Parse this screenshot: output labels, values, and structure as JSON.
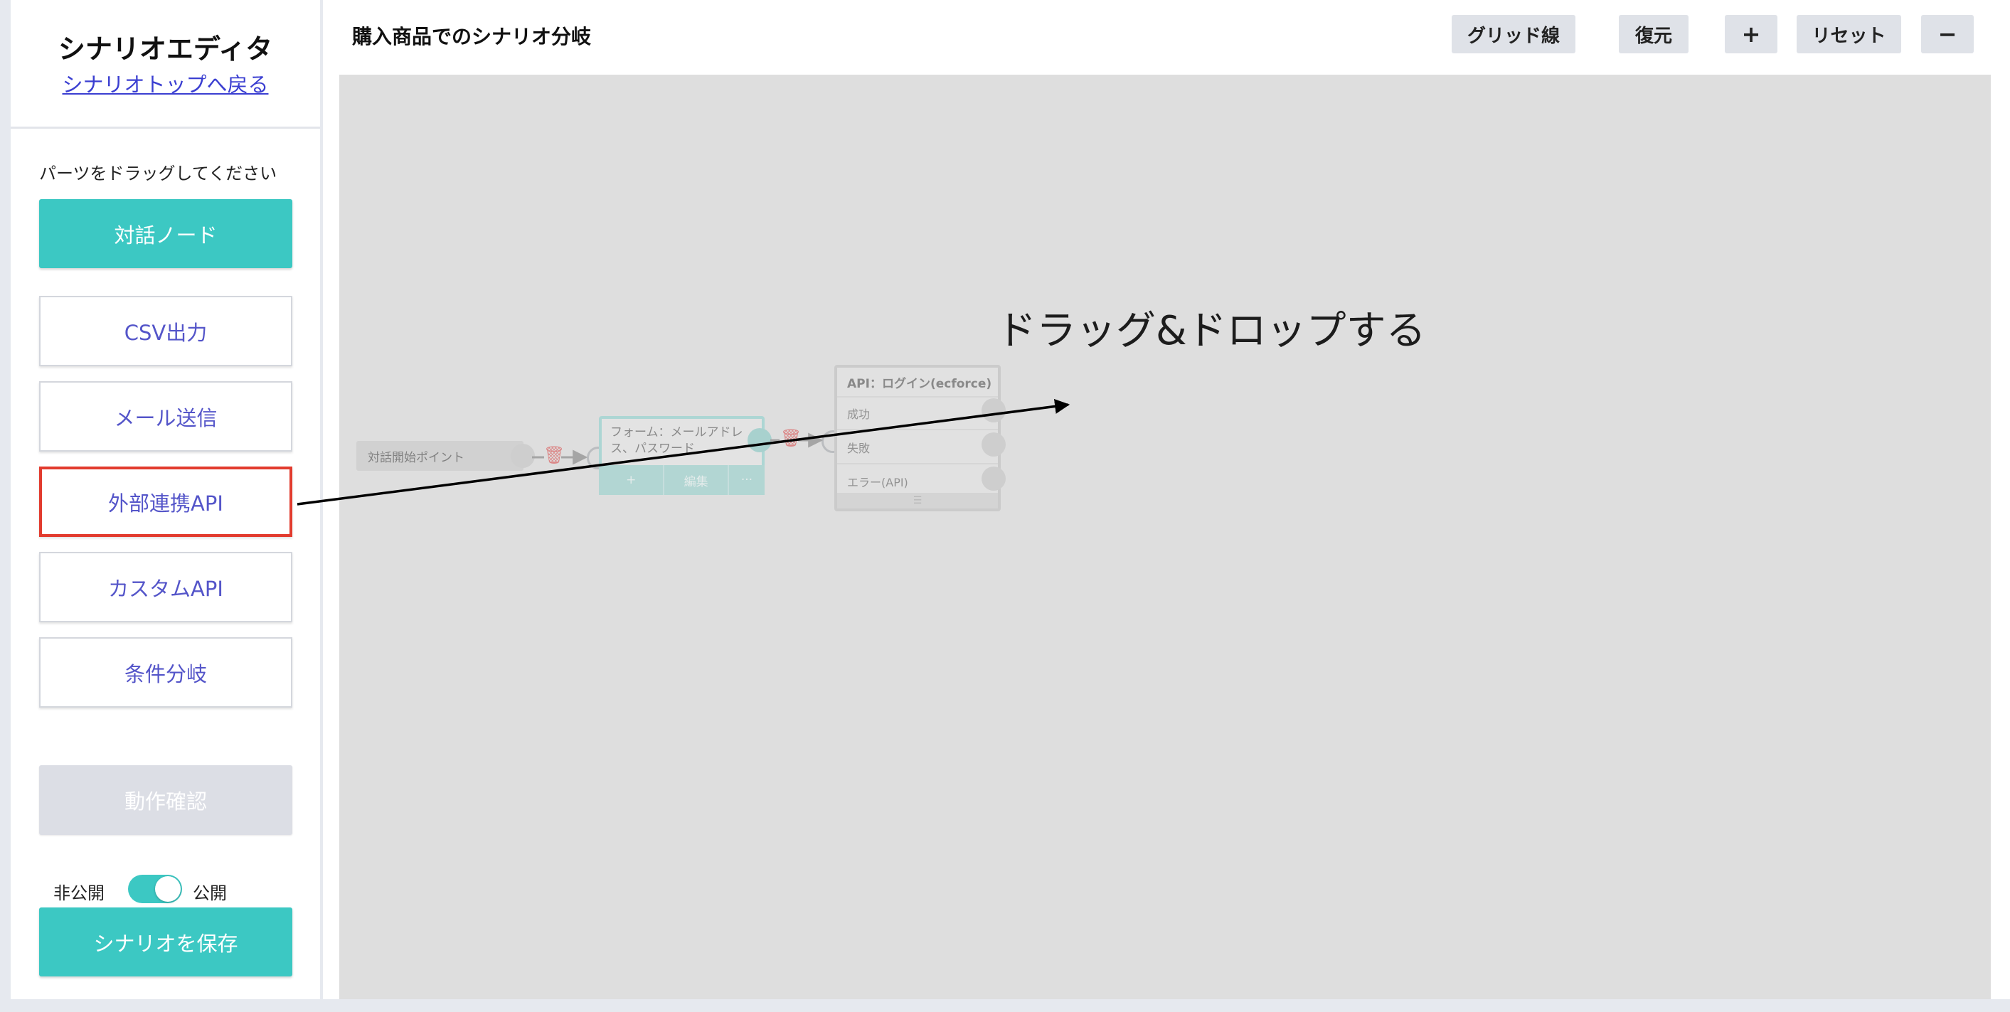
{
  "sidebar": {
    "title": "シナリオエディタ",
    "back_link": "シナリオトップへ戻る",
    "hint": "パーツをドラッグしてください",
    "dialog_node": "対話ノード",
    "parts": [
      "CSV出力",
      "メール送信",
      "外部連携API",
      "カスタムAPI",
      "条件分岐"
    ],
    "highlighted_part": "外部連携API",
    "test_button": "動作確認",
    "visibility": {
      "off_label": "非公開",
      "on_label": "公開",
      "enabled": true
    },
    "save_button": "シナリオを保存"
  },
  "header": {
    "scenario_name": "購入商品でのシナリオ分岐",
    "buttons": {
      "grid": "グリッド線",
      "restore": "復元",
      "zoom_in": "+",
      "reset": "リセット",
      "zoom_out": "−"
    }
  },
  "canvas": {
    "annotation": "ドラッグ&ドロップする",
    "start_node": "対話開始ポイント",
    "form_node": {
      "title": "フォーム：メールアドレス、パスワード",
      "actions": [
        "+",
        "編集",
        "···"
      ]
    },
    "api_node": {
      "title": "API：ログイン(ecforce)",
      "outputs": [
        "成功",
        "失敗",
        "エラー(API)"
      ],
      "footer": "☰"
    }
  },
  "colors": {
    "primary": "#3cc8c3",
    "part_text": "#5455c9",
    "highlight": "#e23b2e",
    "link": "#3b3fd1"
  }
}
